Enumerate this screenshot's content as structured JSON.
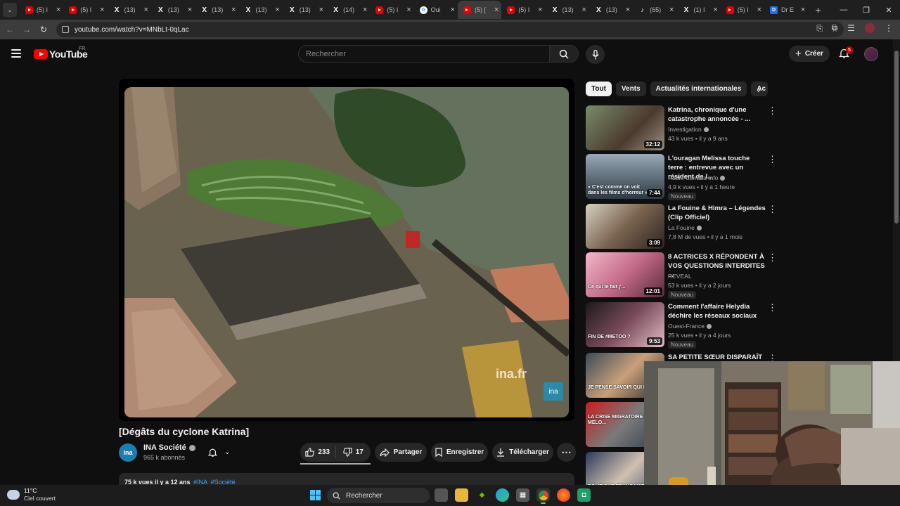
{
  "browser": {
    "tabs": [
      {
        "icon": "youtube-icon",
        "title": "(5) I"
      },
      {
        "icon": "youtube-icon",
        "title": "(5) I"
      },
      {
        "icon": "x-icon",
        "title": "(13)"
      },
      {
        "icon": "x-icon",
        "title": "(13)"
      },
      {
        "icon": "x-icon",
        "title": "(13)"
      },
      {
        "icon": "x-icon",
        "title": "(13)"
      },
      {
        "icon": "x-icon",
        "title": "(13)"
      },
      {
        "icon": "x-icon",
        "title": "(14)"
      },
      {
        "icon": "youtube-icon",
        "title": "(5) I"
      },
      {
        "icon": "google-icon",
        "title": "Oui"
      },
      {
        "icon": "youtube-icon",
        "title": "(5) [",
        "active": true
      },
      {
        "icon": "youtube-icon",
        "title": "(5) I"
      },
      {
        "icon": "x-icon",
        "title": "(13)"
      },
      {
        "icon": "x-icon",
        "title": "(13)"
      },
      {
        "icon": "tiktok-icon",
        "title": "(65)"
      },
      {
        "icon": "x-icon",
        "title": "(1) I"
      },
      {
        "icon": "youtube-icon",
        "title": "(5) I"
      },
      {
        "icon": "doc-icon",
        "title": "Dr E"
      }
    ],
    "url": "youtube.com/watch?v=MNbLt-0qLac"
  },
  "youtube": {
    "logo_text": "YouTube",
    "country_code": "FR",
    "search_placeholder": "Rechercher",
    "create_label": "Créer",
    "notification_count": "5"
  },
  "video": {
    "watermark": "ina.fr",
    "badge": "ina",
    "title": "[Dégâts du cyclone Katrina]",
    "channel_avatar_text": "ina",
    "channel": "INA Société",
    "subscribers": "965 k abonnés",
    "likes": "233",
    "dislikes": "17",
    "share_label": "Partager",
    "save_label": "Enregistrer",
    "download_label": "Télécharger",
    "description_meta": "75 k vues  il y a 12 ans",
    "tags": [
      "#INA",
      "#Société"
    ]
  },
  "chips": [
    "Tout",
    "Vents",
    "Actualités internationales",
    "Ac"
  ],
  "recommendations": [
    {
      "title": "Katrina, chronique d'une catastrophe annoncée - ...",
      "channel": "Investigation",
      "verified": true,
      "meta": "43 k vues • il y a 9 ans",
      "duration": "32:12",
      "badge": "",
      "caption": ""
    },
    {
      "title": "L'ouragan Melissa touche terre : entrevue avec un résident de l...",
      "channel": "Radio-Canada Info",
      "verified": true,
      "meta": "4,9 k vues • il y a 1 heure",
      "duration": "7:44",
      "badge": "Nouveau",
      "caption": "« C'est comme on voit dans les films d'horreur »"
    },
    {
      "title": "La Fouine & Himra – Légendes (Clip Officiel)",
      "channel": "La Fouine",
      "verified": true,
      "meta": "7,8 M de vues • il y a 1 mois",
      "duration": "3:09",
      "badge": "",
      "caption": ""
    },
    {
      "title": "8 ACTRICES X RÉPONDENT À VOS QUESTIONS INTERDITES ...",
      "channel": "REVEAL",
      "verified": false,
      "meta": "53 k vues • il y a 2 jours",
      "duration": "12:01",
      "badge": "Nouveau",
      "caption": "Ce qui te fait j'..."
    },
    {
      "title": "Comment l'affaire Helydia déchire les réseaux sociaux",
      "channel": "Ouest-France",
      "verified": true,
      "meta": "25 k vues • il y a 4 jours",
      "duration": "9:53",
      "badge": "Nouveau",
      "caption": "FIN DE #METOO ?"
    },
    {
      "title": "SA PETITE SŒUR DISPARAÎT",
      "channel": "",
      "verified": false,
      "meta": "",
      "duration": "",
      "badge": "",
      "caption": "JE PENSE SAVOIR QUI L'..."
    },
    {
      "title": "",
      "channel": "",
      "verified": false,
      "meta": "",
      "duration": "",
      "badge": "",
      "caption": "LA CRISE MIGRATOIRE SELON MELO..."
    },
    {
      "title": "",
      "channel": "",
      "verified": false,
      "meta": "",
      "duration": "",
      "badge": "",
      "caption": "POLITIQUE FRANÇAISE"
    }
  ],
  "taskbar": {
    "temperature": "11°C",
    "condition": "Ciel couvert",
    "search_label": "Rechercher"
  }
}
